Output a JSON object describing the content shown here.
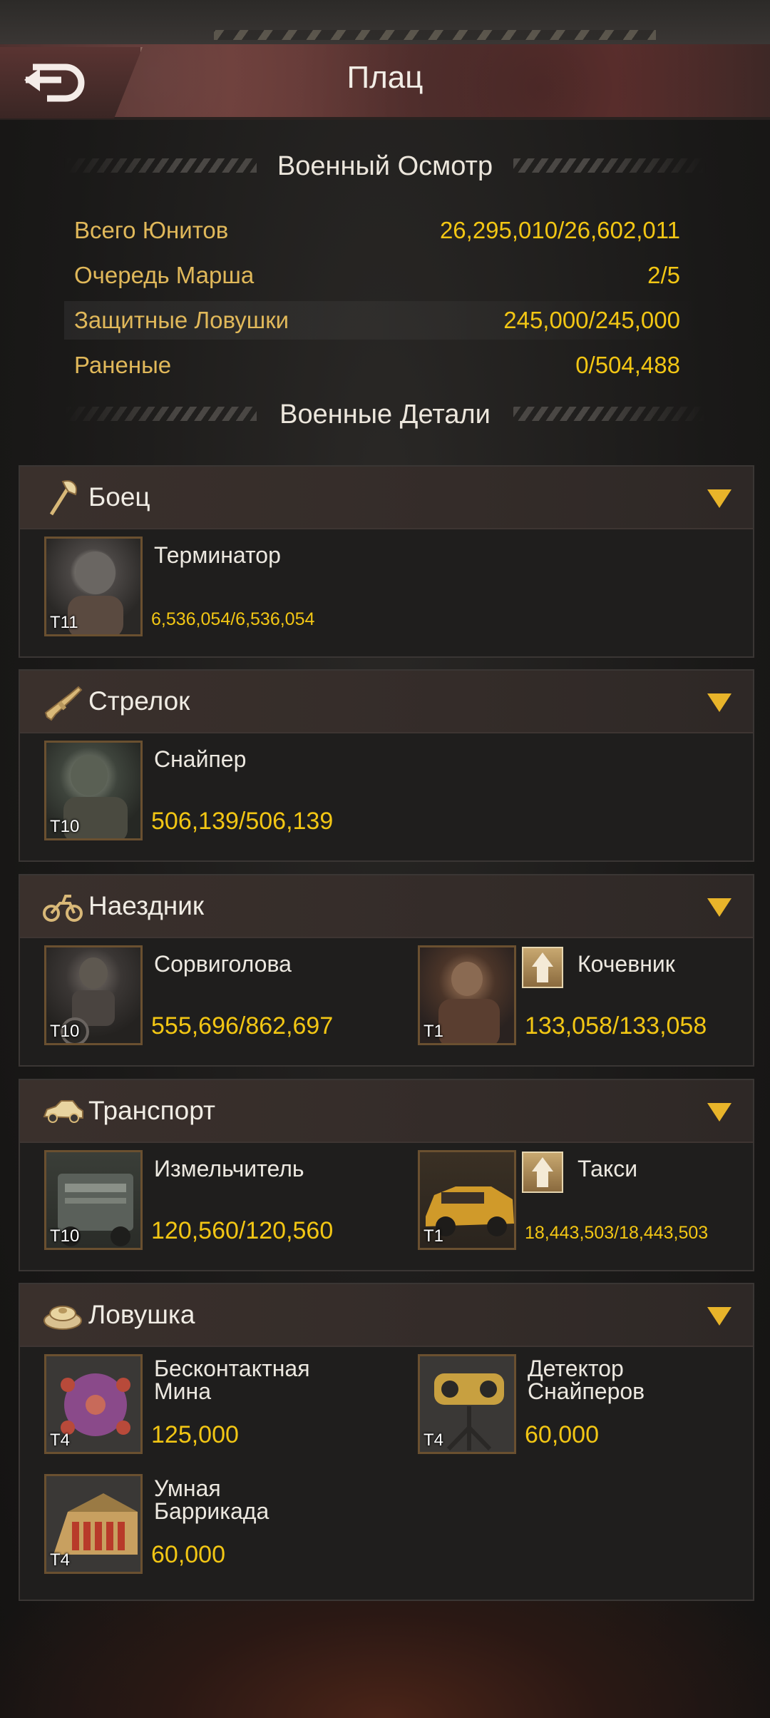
{
  "header": {
    "title": "Плац",
    "back_icon": "back-arrow-icon"
  },
  "overview": {
    "title": "Военный Осмотр",
    "rows": [
      {
        "label": "Всего Юнитов",
        "value": "26,295,010/26,602,011"
      },
      {
        "label": "Очередь Марша",
        "value": "2/5"
      },
      {
        "label": "Защитные Ловушки",
        "value": "245,000/245,000"
      },
      {
        "label": "Раненые",
        "value": "0/504,488"
      }
    ]
  },
  "details": {
    "title": "Военные Детали",
    "categories": [
      {
        "name": "Боец",
        "icon": "axe-icon",
        "units": [
          {
            "name": "Терминатор",
            "tier": "T11",
            "count": "6,536,054/6,536,054"
          }
        ]
      },
      {
        "name": "Стрелок",
        "icon": "rifle-icon",
        "units": [
          {
            "name": "Снайпер",
            "tier": "T10",
            "count": "506,139/506,139"
          }
        ]
      },
      {
        "name": "Наездник",
        "icon": "motorcycle-icon",
        "units": [
          {
            "name": "Сорвиголова",
            "tier": "T10",
            "count": "555,696/862,697"
          },
          {
            "name": "Кочевник",
            "tier": "T1",
            "count": "133,058/133,058",
            "upgrade": true
          }
        ]
      },
      {
        "name": "Транспорт",
        "icon": "car-icon",
        "units": [
          {
            "name": "Измельчитель",
            "tier": "T10",
            "count": "120,560/120,560"
          },
          {
            "name": "Такси",
            "tier": "T1",
            "count": "18,443,503/18,443,503",
            "upgrade": true
          }
        ]
      },
      {
        "name": "Ловушка",
        "icon": "mine-icon",
        "units": [
          {
            "name_line1": "Бесконтактная",
            "name_line2": "Мина",
            "tier": "T4",
            "count": "125,000"
          },
          {
            "name_line1": "Детектор",
            "name_line2": "Снайперов",
            "tier": "T4",
            "count": "60,000"
          },
          {
            "name_line1": "Умная",
            "name_line2": "Баррикада",
            "tier": "T4",
            "count": "60,000"
          }
        ]
      }
    ]
  },
  "colors": {
    "accent": "#f2c614",
    "label": "#e0b85a",
    "toggle": "#e8b42a"
  }
}
